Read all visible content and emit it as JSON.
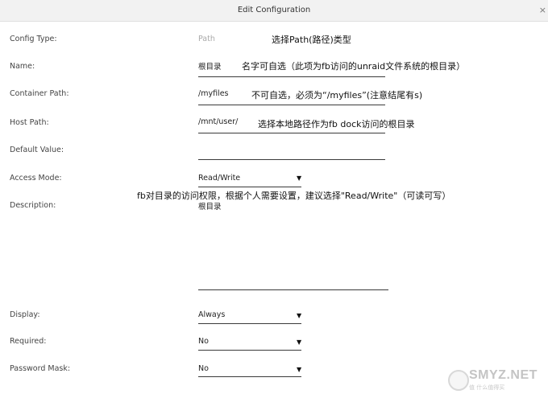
{
  "window": {
    "title": "Edit Configuration",
    "close": "×"
  },
  "fields": {
    "config_type": {
      "label": "Config Type:",
      "value": "Path"
    },
    "name": {
      "label": "Name:",
      "value": "根目录"
    },
    "container_path": {
      "label": "Container Path:",
      "value": "/myfiles"
    },
    "host_path": {
      "label": "Host Path:",
      "value": "/mnt/user/"
    },
    "default_value": {
      "label": "Default Value:",
      "value": ""
    },
    "access_mode": {
      "label": "Access Mode:",
      "value": "Read/Write"
    },
    "description": {
      "label": "Description:",
      "value": "根目录"
    },
    "display": {
      "label": "Display:",
      "value": "Always"
    },
    "required": {
      "label": "Required:",
      "value": "No"
    },
    "password_mask": {
      "label": "Password Mask:",
      "value": "No"
    }
  },
  "annotations": {
    "config_type": "选择Path(路径)类型",
    "name": "名字可自选（此项为fb访问的unraid文件系统的根目录）",
    "container_path": "不可自选，必须为“/myfiles”(注意结尾有s)",
    "host_path": "选择本地路径作为fb dock访问的根目录",
    "access_mode": "fb对目录的访问权限，根据个人需要设置，建议选择\"Read/Write\"（可读可写）"
  },
  "watermark": {
    "text": "SMYZ.NET",
    "sub": "值 什么值得买"
  },
  "dropdown_caret": "▼"
}
